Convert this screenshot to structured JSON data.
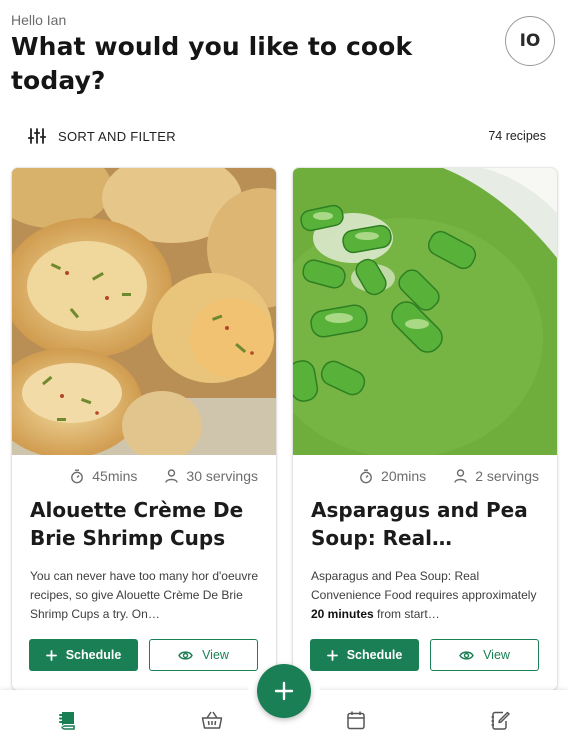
{
  "header": {
    "greeting": "Hello Ian",
    "headline": "What would you like to cook today?",
    "avatar_initials": "IO"
  },
  "toolbar": {
    "sort_filter_label": "SORT AND FILTER",
    "recipe_count": "74 recipes",
    "sort_icon": "sliders-icon"
  },
  "recipes": [
    {
      "time": "45mins",
      "servings": "30 servings",
      "title": "Alouette Crème De Brie Shrimp Cups",
      "description": "You can never have too many hor d'oeuvre recipes, so give Alouette Crème De Brie Shrimp Cups a try. On…",
      "image": "pastry-shrimp-cups",
      "schedule_label": "Schedule",
      "view_label": "View"
    },
    {
      "time": "20mins",
      "servings": "2 servings",
      "title": "Asparagus and Pea Soup: Real…",
      "description_prefix": "Asparagus and Pea Soup: Real Convenience Food requires approximately ",
      "description_bold": "20 minutes",
      "description_suffix": " from start…",
      "image": "green-pea-soup",
      "schedule_label": "Schedule",
      "view_label": "View"
    }
  ],
  "bottom_nav": {
    "items": [
      "recipes-book-icon",
      "basket-icon",
      "calendar-icon",
      "notes-icon"
    ],
    "fab_icon": "plus-icon"
  },
  "colors": {
    "accent": "#1b7f55",
    "text": "#1a1a1a",
    "muted": "#6d6d6d",
    "soup_green": "#6fae3c",
    "pastry_gold": "#e3bd73"
  }
}
